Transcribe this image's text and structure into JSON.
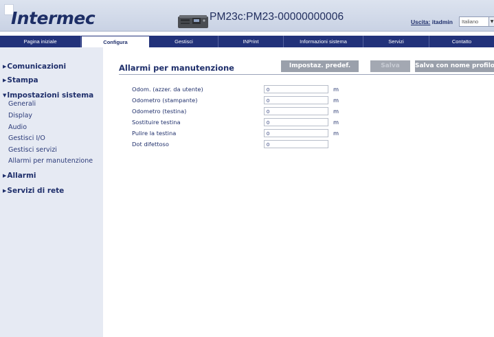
{
  "header": {
    "logo_text": "Intermec",
    "device_title": "PM23c:PM23-00000000006",
    "logout_label": "Uscita:",
    "username": "itadmin",
    "language_selected": "Italiano"
  },
  "nav": {
    "tabs": [
      {
        "label": "Pagina iniziale"
      },
      {
        "label": "Configura"
      },
      {
        "label": "Gestisci"
      },
      {
        "label": "INPrint"
      },
      {
        "label": "Informazioni sistema"
      },
      {
        "label": "Servizi"
      },
      {
        "label": "Contatto"
      }
    ],
    "active_tab": "Configura"
  },
  "sidebar": {
    "sections": [
      {
        "label": "Comunicazioni",
        "expanded": false
      },
      {
        "label": "Stampa",
        "expanded": false
      },
      {
        "label": "Impostazioni sistema",
        "expanded": true
      },
      {
        "label": "Allarmi",
        "expanded": false
      },
      {
        "label": "Servizi di rete",
        "expanded": false
      }
    ],
    "system_items": [
      {
        "label": "Generali"
      },
      {
        "label": "Display"
      },
      {
        "label": "Audio"
      },
      {
        "label": "Gestisci I/O"
      },
      {
        "label": "Gestisci servizi"
      },
      {
        "label": "Allarmi per manutenzione"
      }
    ]
  },
  "main": {
    "title": "Allarmi per manutenzione",
    "buttons": {
      "defaults": "Impostaz. predef.",
      "save": "Salva",
      "save_as": "Salva con nome profilo"
    },
    "rows": [
      {
        "label": "Odom. (azzer. da utente)",
        "value": "0",
        "unit": "m"
      },
      {
        "label": "Odometro (stampante)",
        "value": "0",
        "unit": "m"
      },
      {
        "label": "Odometro (testina)",
        "value": "0",
        "unit": "m"
      },
      {
        "label": "Sostituire testina",
        "value": "0",
        "unit": "m"
      },
      {
        "label": "Pulire la testina",
        "value": "0",
        "unit": "m"
      },
      {
        "label": "Dot difettoso",
        "value": "0",
        "unit": ""
      }
    ]
  },
  "colors": {
    "navbar": "#22327a",
    "text_primary": "#1f2f6b",
    "sidebar_bg": "#e6eaf3",
    "button_bg": "#9aa0ab"
  }
}
